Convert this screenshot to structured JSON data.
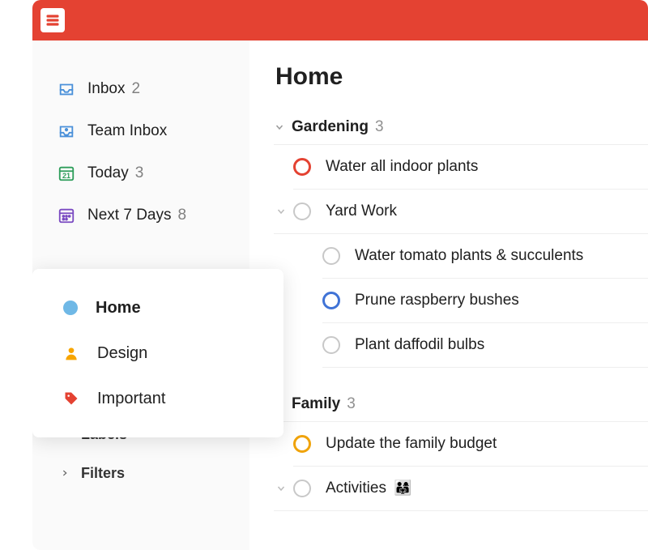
{
  "header": {},
  "sidebar": {
    "nav": [
      {
        "id": "inbox",
        "label": "Inbox",
        "count": "2"
      },
      {
        "id": "team",
        "label": "Team Inbox",
        "count": ""
      },
      {
        "id": "today",
        "label": "Today",
        "count": "3"
      },
      {
        "id": "next7",
        "label": "Next 7 Days",
        "count": "8"
      }
    ],
    "projects": [
      {
        "id": "home",
        "label": "Home",
        "kind": "dot",
        "color": "#6fb8e6",
        "active": true
      },
      {
        "id": "design",
        "label": "Design",
        "kind": "person",
        "color": "#f7a500"
      },
      {
        "id": "important",
        "label": "Important",
        "kind": "tag",
        "color": "#e44232"
      }
    ],
    "groups": [
      {
        "id": "labels",
        "label": "Labels"
      },
      {
        "id": "filters",
        "label": "Filters"
      }
    ]
  },
  "content": {
    "title": "Home",
    "sections": [
      {
        "id": "gardening",
        "name": "Gardening",
        "count": "3",
        "tasks": [
          {
            "title": "Water all indoor plants",
            "priority": "p1"
          },
          {
            "title": "Yard Work",
            "priority": "none",
            "hasChildren": true,
            "children": [
              {
                "title": "Water tomato plants & succulents",
                "priority": "none"
              },
              {
                "title": "Prune raspberry bushes",
                "priority": "p3"
              },
              {
                "title": "Plant daffodil bulbs",
                "priority": "none"
              }
            ]
          }
        ]
      },
      {
        "id": "family",
        "name": "Family",
        "count": "3",
        "tasks": [
          {
            "title": "Update the family budget",
            "priority": "p2"
          },
          {
            "title": "Activities",
            "priority": "none",
            "hasChildren": true,
            "emoji": "👨‍👩‍👧"
          }
        ]
      }
    ]
  },
  "icons": {
    "today_date": "21"
  }
}
